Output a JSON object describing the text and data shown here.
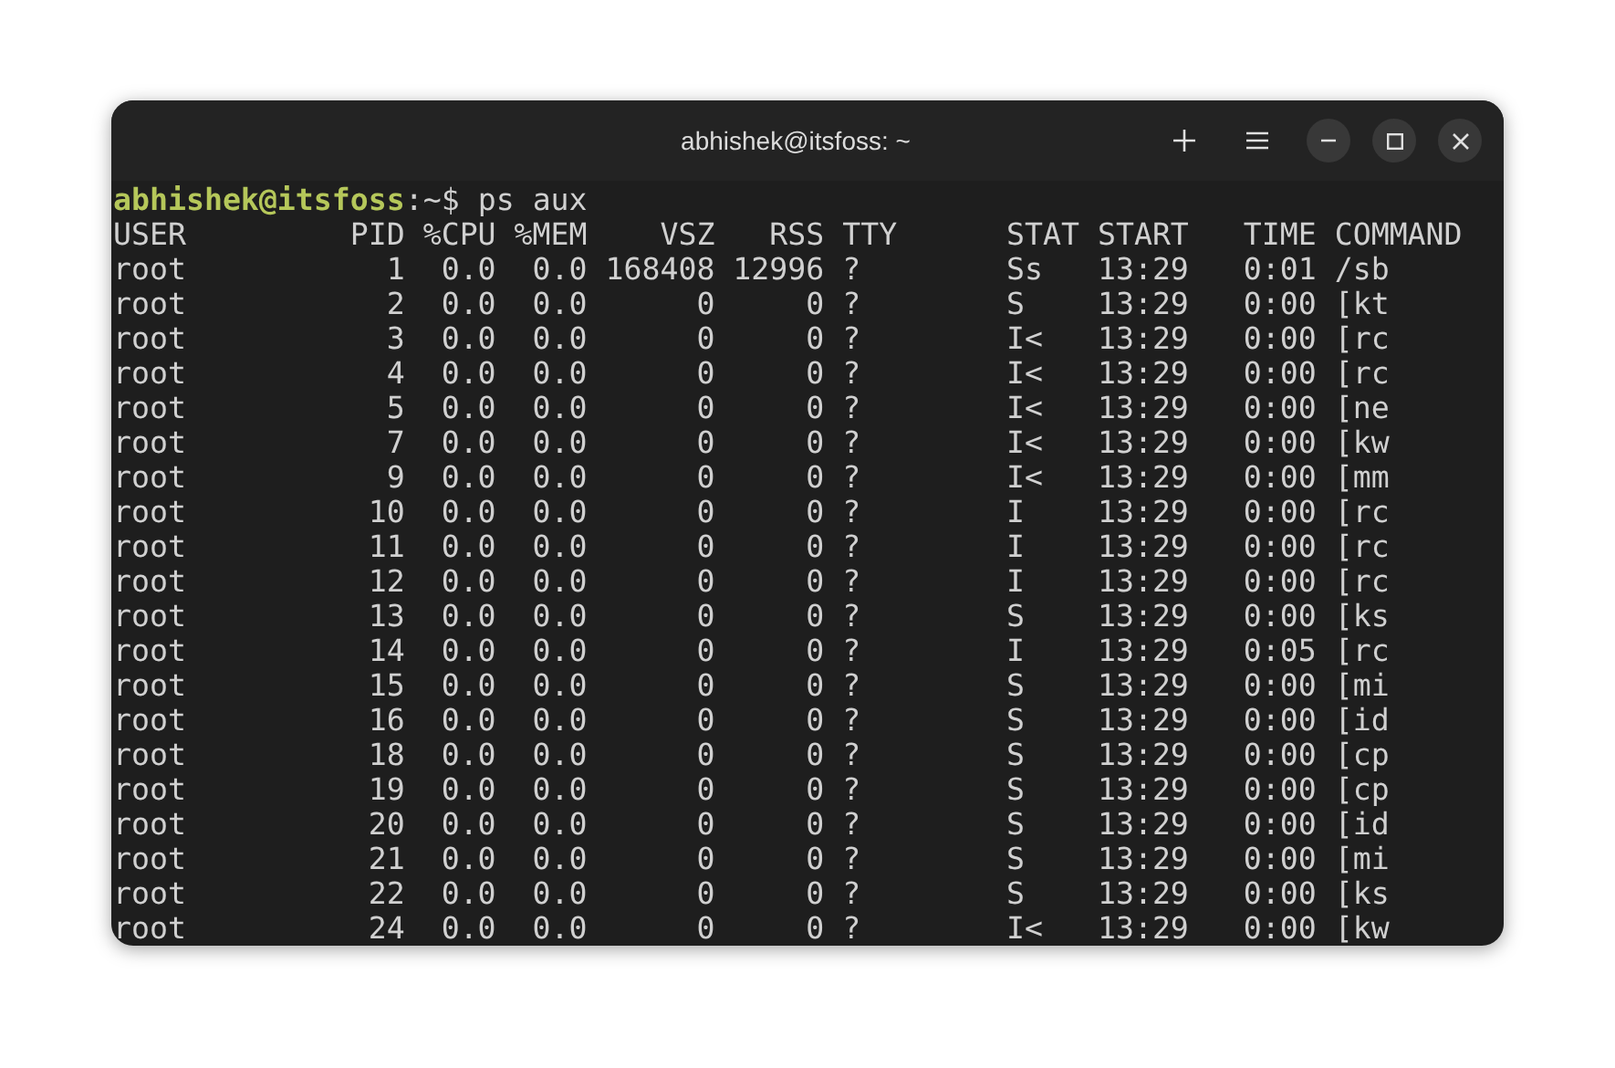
{
  "window": {
    "title": "abhishek@itsfoss: ~"
  },
  "prompt": {
    "user_host": "abhishek@itsfoss",
    "path": ":~$",
    "command": "ps aux"
  },
  "table": {
    "columns": [
      "USER",
      "PID",
      "%CPU",
      "%MEM",
      "VSZ",
      "RSS",
      "TTY",
      "STAT",
      "START",
      "TIME",
      "COMMAND"
    ],
    "rows": [
      {
        "user": "root",
        "pid": "1",
        "cpu": "0.0",
        "mem": "0.0",
        "vsz": "168408",
        "rss": "12996",
        "tty": "?",
        "stat": "Ss",
        "start": "13:29",
        "time": "0:01",
        "command": "/sb"
      },
      {
        "user": "root",
        "pid": "2",
        "cpu": "0.0",
        "mem": "0.0",
        "vsz": "0",
        "rss": "0",
        "tty": "?",
        "stat": "S",
        "start": "13:29",
        "time": "0:00",
        "command": "[kt"
      },
      {
        "user": "root",
        "pid": "3",
        "cpu": "0.0",
        "mem": "0.0",
        "vsz": "0",
        "rss": "0",
        "tty": "?",
        "stat": "I<",
        "start": "13:29",
        "time": "0:00",
        "command": "[rc"
      },
      {
        "user": "root",
        "pid": "4",
        "cpu": "0.0",
        "mem": "0.0",
        "vsz": "0",
        "rss": "0",
        "tty": "?",
        "stat": "I<",
        "start": "13:29",
        "time": "0:00",
        "command": "[rc"
      },
      {
        "user": "root",
        "pid": "5",
        "cpu": "0.0",
        "mem": "0.0",
        "vsz": "0",
        "rss": "0",
        "tty": "?",
        "stat": "I<",
        "start": "13:29",
        "time": "0:00",
        "command": "[ne"
      },
      {
        "user": "root",
        "pid": "7",
        "cpu": "0.0",
        "mem": "0.0",
        "vsz": "0",
        "rss": "0",
        "tty": "?",
        "stat": "I<",
        "start": "13:29",
        "time": "0:00",
        "command": "[kw"
      },
      {
        "user": "root",
        "pid": "9",
        "cpu": "0.0",
        "mem": "0.0",
        "vsz": "0",
        "rss": "0",
        "tty": "?",
        "stat": "I<",
        "start": "13:29",
        "time": "0:00",
        "command": "[mm"
      },
      {
        "user": "root",
        "pid": "10",
        "cpu": "0.0",
        "mem": "0.0",
        "vsz": "0",
        "rss": "0",
        "tty": "?",
        "stat": "I",
        "start": "13:29",
        "time": "0:00",
        "command": "[rc"
      },
      {
        "user": "root",
        "pid": "11",
        "cpu": "0.0",
        "mem": "0.0",
        "vsz": "0",
        "rss": "0",
        "tty": "?",
        "stat": "I",
        "start": "13:29",
        "time": "0:00",
        "command": "[rc"
      },
      {
        "user": "root",
        "pid": "12",
        "cpu": "0.0",
        "mem": "0.0",
        "vsz": "0",
        "rss": "0",
        "tty": "?",
        "stat": "I",
        "start": "13:29",
        "time": "0:00",
        "command": "[rc"
      },
      {
        "user": "root",
        "pid": "13",
        "cpu": "0.0",
        "mem": "0.0",
        "vsz": "0",
        "rss": "0",
        "tty": "?",
        "stat": "S",
        "start": "13:29",
        "time": "0:00",
        "command": "[ks"
      },
      {
        "user": "root",
        "pid": "14",
        "cpu": "0.0",
        "mem": "0.0",
        "vsz": "0",
        "rss": "0",
        "tty": "?",
        "stat": "I",
        "start": "13:29",
        "time": "0:05",
        "command": "[rc"
      },
      {
        "user": "root",
        "pid": "15",
        "cpu": "0.0",
        "mem": "0.0",
        "vsz": "0",
        "rss": "0",
        "tty": "?",
        "stat": "S",
        "start": "13:29",
        "time": "0:00",
        "command": "[mi"
      },
      {
        "user": "root",
        "pid": "16",
        "cpu": "0.0",
        "mem": "0.0",
        "vsz": "0",
        "rss": "0",
        "tty": "?",
        "stat": "S",
        "start": "13:29",
        "time": "0:00",
        "command": "[id"
      },
      {
        "user": "root",
        "pid": "18",
        "cpu": "0.0",
        "mem": "0.0",
        "vsz": "0",
        "rss": "0",
        "tty": "?",
        "stat": "S",
        "start": "13:29",
        "time": "0:00",
        "command": "[cp"
      },
      {
        "user": "root",
        "pid": "19",
        "cpu": "0.0",
        "mem": "0.0",
        "vsz": "0",
        "rss": "0",
        "tty": "?",
        "stat": "S",
        "start": "13:29",
        "time": "0:00",
        "command": "[cp"
      },
      {
        "user": "root",
        "pid": "20",
        "cpu": "0.0",
        "mem": "0.0",
        "vsz": "0",
        "rss": "0",
        "tty": "?",
        "stat": "S",
        "start": "13:29",
        "time": "0:00",
        "command": "[id"
      },
      {
        "user": "root",
        "pid": "21",
        "cpu": "0.0",
        "mem": "0.0",
        "vsz": "0",
        "rss": "0",
        "tty": "?",
        "stat": "S",
        "start": "13:29",
        "time": "0:00",
        "command": "[mi"
      },
      {
        "user": "root",
        "pid": "22",
        "cpu": "0.0",
        "mem": "0.0",
        "vsz": "0",
        "rss": "0",
        "tty": "?",
        "stat": "S",
        "start": "13:29",
        "time": "0:00",
        "command": "[ks"
      },
      {
        "user": "root",
        "pid": "24",
        "cpu": "0.0",
        "mem": "0.0",
        "vsz": "0",
        "rss": "0",
        "tty": "?",
        "stat": "I<",
        "start": "13:29",
        "time": "0:00",
        "command": "[kw"
      }
    ]
  }
}
